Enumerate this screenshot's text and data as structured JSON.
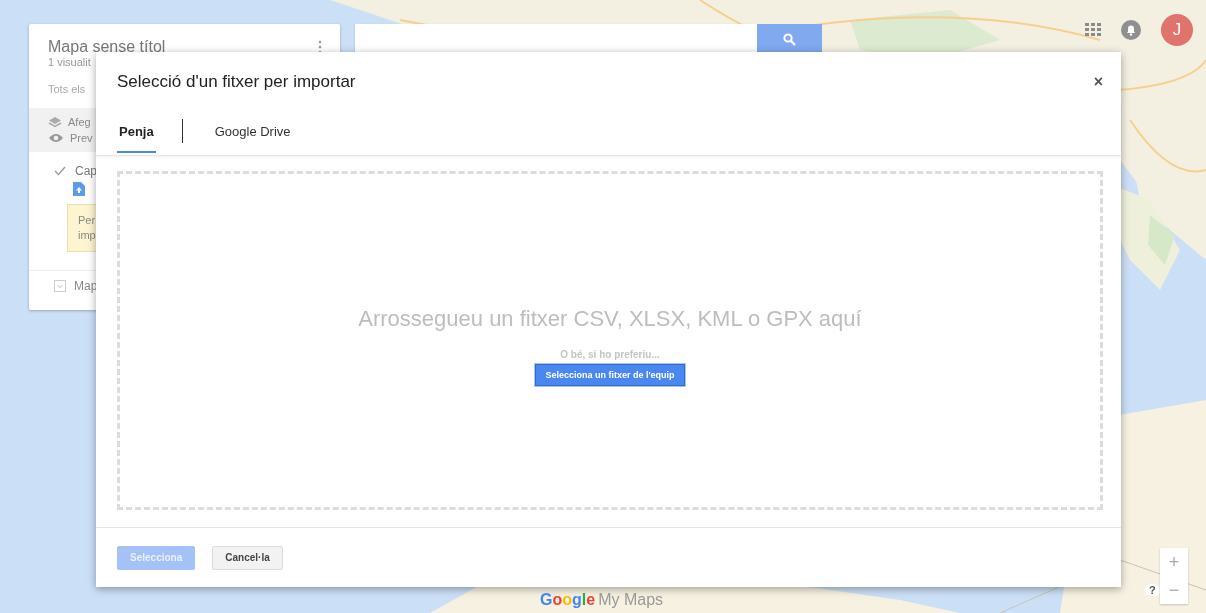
{
  "panel": {
    "title": "Mapa sense títol",
    "subtitle": "1 visualit",
    "layers_link": "Tots els",
    "actions": [
      {
        "kind": "layers",
        "label": "Afeg"
      },
      {
        "kind": "preview",
        "label": "Prev"
      }
    ],
    "layer": {
      "name": "Cap",
      "checked": true
    },
    "notice": [
      "Per",
      "imp"
    ],
    "base_map": "Map"
  },
  "account": {
    "initial": "J"
  },
  "dialog": {
    "title": "Selecció d'un fitxer per importar",
    "close": "×",
    "tabs": [
      {
        "label": "Penja",
        "selected": true
      },
      {
        "label": "Google Drive",
        "selected": false
      }
    ],
    "drop_text": "Arrossegueu un fitxer CSV, XLSX, KML o GPX aquí",
    "alt_text": "O bé, si ho preferiu...",
    "pick_button": "Selecciona un fitxer de l'equip",
    "buttons": [
      {
        "label": "Selecciona",
        "disabled": true
      },
      {
        "label": "Cancel·la",
        "disabled": false
      }
    ]
  },
  "branding": {
    "logo_google": "Google",
    "logo_product": "My Maps"
  },
  "map_controls": {
    "zoom_in": "+",
    "zoom_out": "−",
    "help": "?"
  }
}
